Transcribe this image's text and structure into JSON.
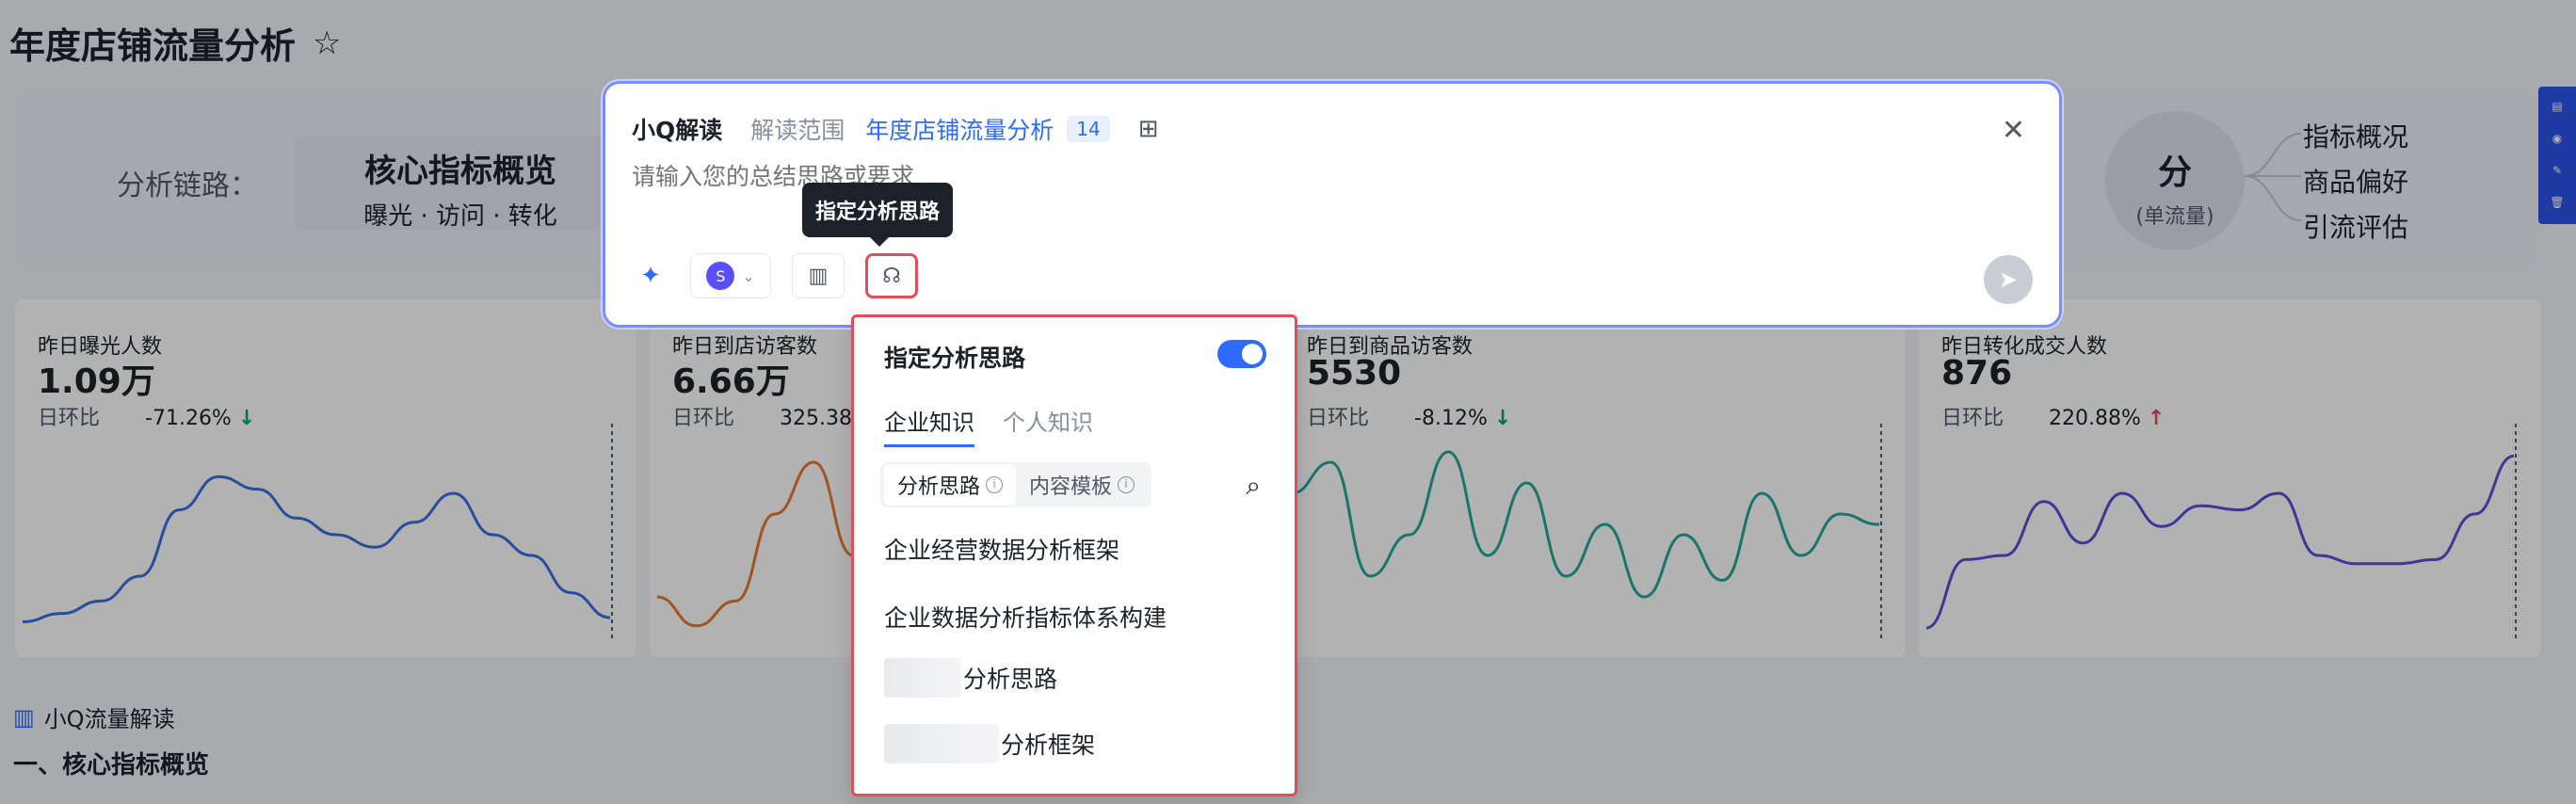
{
  "page": {
    "title": "年度店铺流量分析"
  },
  "chain": {
    "label": "分析链路：",
    "core_title": "核心指标概览",
    "core_sub": "曝光 · 访问 · 转化",
    "split_title": "分",
    "split_sub": "(单流量)",
    "split_items": [
      "指标概况",
      "商品偏好",
      "引流评估"
    ]
  },
  "cards": [
    {
      "label": "昨日曝光人数",
      "value": "1.09万",
      "ratio_label": "日环比",
      "ratio": "-71.26%",
      "trend": "down",
      "color": "#3a6fe0",
      "series": [
        8,
        12,
        18,
        30,
        62,
        78,
        72,
        58,
        50,
        44,
        56,
        70,
        50,
        40,
        22,
        10
      ]
    },
    {
      "label": "昨日到店访客数",
      "value": "6.66万",
      "ratio_label": "日环比",
      "ratio": "325.38%",
      "trend": "up",
      "color": "#e57a2e",
      "series": [
        20,
        6,
        18,
        60,
        85,
        40,
        22,
        30,
        55,
        38,
        24,
        40,
        30,
        25,
        20,
        12
      ]
    },
    {
      "label": "昨日到商品访客数",
      "value": "5530",
      "ratio_label": "日环比",
      "ratio": "-8.12%",
      "trend": "down",
      "color": "#21a89a",
      "series": [
        70,
        85,
        30,
        50,
        90,
        40,
        75,
        30,
        55,
        20,
        50,
        28,
        70,
        40,
        60,
        55
      ]
    },
    {
      "label": "昨日转化成交人数",
      "value": "876",
      "ratio_label": "日环比",
      "ratio": "220.88%",
      "trend": "up",
      "color": "#5a4fd6",
      "series": [
        5,
        38,
        40,
        66,
        46,
        70,
        54,
        64,
        62,
        70,
        40,
        36,
        36,
        38,
        60,
        88
      ]
    }
  ],
  "readout": {
    "title": "小Q流量解读",
    "section": "一、核心指标概览"
  },
  "panel": {
    "brand": "小Q解读",
    "scope_label": "解读范围",
    "target": "年度店铺流量分析",
    "target_count": "14",
    "placeholder": "请输入您的总结思路或要求",
    "tooltip": "指定分析思路"
  },
  "dropdown": {
    "title": "指定分析思路",
    "toggle_on": true,
    "tabs": [
      "企业知识",
      "个人知识"
    ],
    "segments": [
      "分析思路",
      "内容模板"
    ],
    "items": [
      "企业经营数据分析框架",
      "企业数据分析指标体系构建",
      "分析思路",
      "分析框架"
    ]
  }
}
